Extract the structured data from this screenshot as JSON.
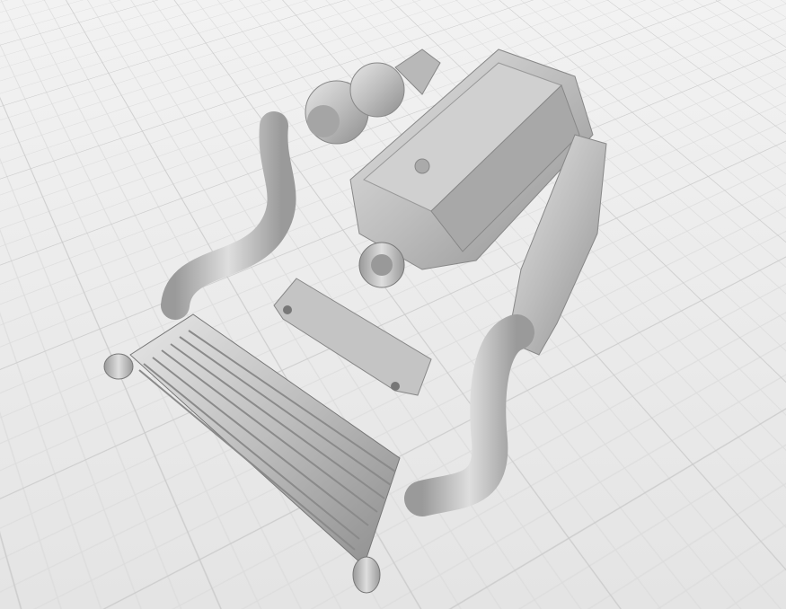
{
  "scene": {
    "background_color": "#ececec",
    "grid_color": "#c9c9c9",
    "part_color": "#bdbdbd",
    "parts": [
      "engine-block",
      "turbocharger",
      "intake-pipe",
      "intercooler",
      "bracket",
      "intercooler-pipe"
    ]
  }
}
